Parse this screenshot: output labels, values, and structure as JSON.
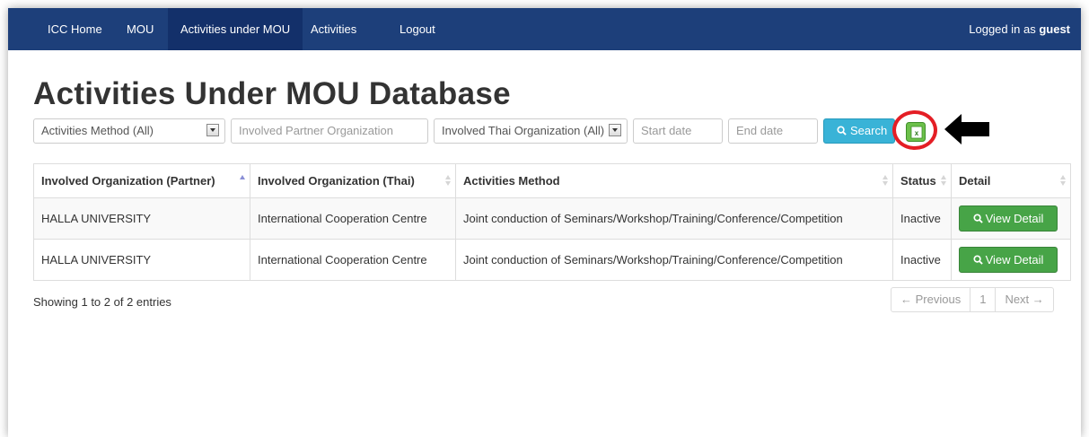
{
  "nav": {
    "items": [
      "ICC Home",
      "MOU",
      "Activities under MOU",
      "Activities",
      "Logout"
    ],
    "active_index": 2,
    "logged_in_prefix": "Logged in as",
    "logged_in_user": "guest"
  },
  "page_title": "Activities Under MOU Database",
  "filters": {
    "method_select": "Activities Method (All)",
    "partner_placeholder": "Involved Partner Organization",
    "thai_select": "Involved Thai Organization (All)",
    "start_placeholder": "Start date",
    "end_placeholder": "End date",
    "search_label": "Search"
  },
  "table": {
    "headers": [
      "Involved Organization (Partner)",
      "Involved Organization (Thai)",
      "Activities Method",
      "Status",
      "Detail"
    ],
    "rows": [
      {
        "partner": "HALLA UNIVERSITY",
        "thai": "International Cooperation Centre",
        "method": "Joint conduction of Seminars/Workshop/Training/Conference/Competition",
        "status": "Inactive",
        "detail": "View Detail"
      },
      {
        "partner": "HALLA UNIVERSITY",
        "thai": "International Cooperation Centre",
        "method": "Joint conduction of Seminars/Workshop/Training/Conference/Competition",
        "status": "Inactive",
        "detail": "View Detail"
      }
    ]
  },
  "info_text": "Showing 1 to 2 of 2 entries",
  "pagination": {
    "previous": "← Previous",
    "page": "1",
    "next": "Next →"
  },
  "colors": {
    "navbar": "#1d3f7a",
    "search_button": "#39b3d7",
    "view_button": "#47a447",
    "highlight_ring": "#e41e25"
  }
}
